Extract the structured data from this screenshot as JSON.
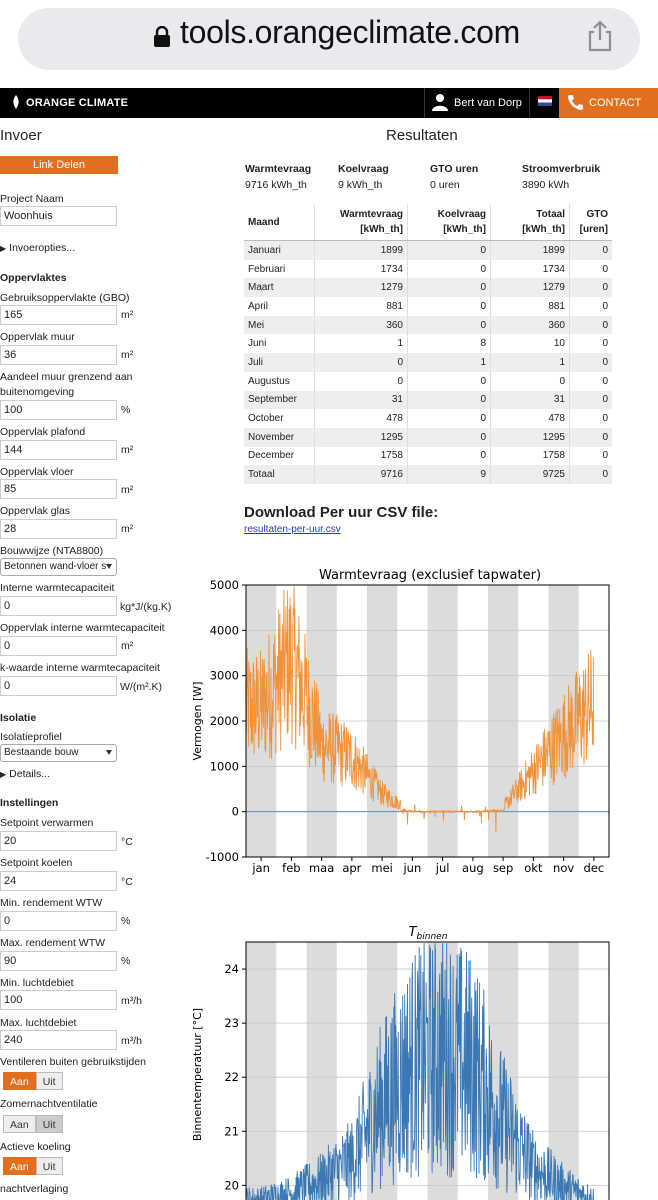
{
  "browser": {
    "url": "tools.orangeclimate.com"
  },
  "nav": {
    "logo": "ORANGE CLIMATE",
    "user": "Bert van Dorp",
    "contact": "CONTACT"
  },
  "left": {
    "title": "Invoer",
    "share_button": "Link Delen",
    "project_label": "Project Naam",
    "project_value": "Woonhuis",
    "options_toggle": "Invoeropties...",
    "section_areas": "Oppervlaktes",
    "fields": [
      {
        "label": "Gebruiksoppervlakte (GBO)",
        "value": "165",
        "unit": "m²"
      },
      {
        "label": "Oppervlak muur",
        "value": "36",
        "unit": "m²"
      },
      {
        "label": "Aandeel muur grenzend aan",
        "label2": "buitenomgeving",
        "value": "100",
        "unit": "%"
      },
      {
        "label": "Oppervlak plafond",
        "value": "144",
        "unit": "m²"
      },
      {
        "label": "Oppervlak vloer",
        "value": "85",
        "unit": "m²"
      },
      {
        "label": "Oppervlak glas",
        "value": "28",
        "unit": "m²"
      }
    ],
    "bouwwijze_label": "Bouwwijze (NTA8800)",
    "bouwwijze_value": "Betonnen wand-vloer s",
    "fields2": [
      {
        "label": "Interne warmtecapaciteit",
        "value": "0",
        "unit": "kg*J/(kg.K)"
      },
      {
        "label": "Oppervlak interne warmtecapaciteit",
        "value": "0",
        "unit": "m²"
      },
      {
        "label": "k-waarde interne warmtecapaciteit",
        "value": "0",
        "unit": "W/(m².K)"
      }
    ],
    "section_isolation": "Isolatie",
    "isolation_label": "Isolatieprofiel",
    "isolation_value": "Bestaande bouw",
    "details_toggle": "Details...",
    "section_settings": "Instellingen",
    "fields3": [
      {
        "label": "Setpoint verwarmen",
        "value": "20",
        "unit": "°C"
      },
      {
        "label": "Setpoint koelen",
        "value": "24",
        "unit": "°C"
      },
      {
        "label": "Min. rendement WTW",
        "value": "0",
        "unit": "%"
      },
      {
        "label": "Max. rendement WTW",
        "value": "90",
        "unit": "%"
      },
      {
        "label": "Min. luchtdebiet",
        "value": "100",
        "unit": "m³/h"
      },
      {
        "label": "Max. luchtdebiet",
        "value": "240",
        "unit": "m³/h"
      }
    ],
    "toggles": [
      {
        "label": "Ventileren buiten gebruikstijden",
        "on": "Aan",
        "off": "Uit",
        "active": "on"
      },
      {
        "label": "Zomernachtventilatie",
        "on": "Aan",
        "off": "Uit",
        "active": "off"
      },
      {
        "label": "Actieve koeling",
        "on": "Aan",
        "off": "Uit",
        "active": "on"
      }
    ],
    "last_label": "nachtverlaging"
  },
  "results": {
    "title": "Resultaten",
    "summary": [
      {
        "key": "Warmtevraag",
        "value": "9716 kWh_th"
      },
      {
        "key": "Koelvraag",
        "value": "9 kWh_th"
      },
      {
        "key": "GTO uren",
        "value": "0 uren"
      },
      {
        "key": "Stroomverbruik",
        "value": "3890 kWh"
      }
    ],
    "table_headers": [
      "Maand",
      "Warmtevraag [kWh_th]",
      "Koelvraag [kWh_th]",
      "Totaal [kWh_th]",
      "GTO [uren]"
    ],
    "table_rows": [
      [
        "Januari",
        "1899",
        "0",
        "1899",
        "0"
      ],
      [
        "Februari",
        "1734",
        "0",
        "1734",
        "0"
      ],
      [
        "Maart",
        "1279",
        "0",
        "1279",
        "0"
      ],
      [
        "April",
        "881",
        "0",
        "881",
        "0"
      ],
      [
        "Mei",
        "360",
        "0",
        "360",
        "0"
      ],
      [
        "Juni",
        "1",
        "8",
        "10",
        "0"
      ],
      [
        "Juli",
        "0",
        "1",
        "1",
        "0"
      ],
      [
        "Augustus",
        "0",
        "0",
        "0",
        "0"
      ],
      [
        "September",
        "31",
        "0",
        "31",
        "0"
      ],
      [
        "October",
        "478",
        "0",
        "478",
        "0"
      ],
      [
        "November",
        "1295",
        "0",
        "1295",
        "0"
      ],
      [
        "December",
        "1758",
        "0",
        "1758",
        "0"
      ],
      [
        "Totaal",
        "9716",
        "9",
        "9725",
        "0"
      ]
    ],
    "download_title": "Download Per uur CSV file:",
    "download_link": "resultaten-per-uur.csv"
  },
  "chart_data": [
    {
      "type": "line",
      "title": "Warmtevraag (exclusief tapwater)",
      "ylabel": "Vermogen [W]",
      "xlabel": "",
      "categories": [
        "jan",
        "feb",
        "maa",
        "apr",
        "mei",
        "jun",
        "jul",
        "aug",
        "sep",
        "okt",
        "nov",
        "dec"
      ],
      "ylim": [
        -1000,
        5000
      ],
      "yticks": [
        -1000,
        0,
        1000,
        2000,
        3000,
        4000,
        5000
      ],
      "color": "#f0923a",
      "grid": true,
      "series": [
        {
          "values": [
            2300,
            3400,
            1500,
            1200,
            400,
            0,
            0,
            0,
            100,
            900,
            1700,
            2400
          ]
        }
      ]
    },
    {
      "type": "line",
      "title": "T_binnen",
      "ylabel": "Binnentemperatuur [°C]",
      "xlabel": "",
      "ylim": [
        19.6,
        24.5
      ],
      "yticks": [
        20,
        21,
        22,
        23,
        24
      ],
      "color": "#3a78b5",
      "grid": true,
      "series": [
        {
          "values": [
            19.7,
            19.8,
            20.0,
            20.3,
            21.2,
            21.8,
            22.0,
            21.8,
            20.9,
            20.2,
            19.9,
            19.7
          ]
        }
      ]
    }
  ]
}
